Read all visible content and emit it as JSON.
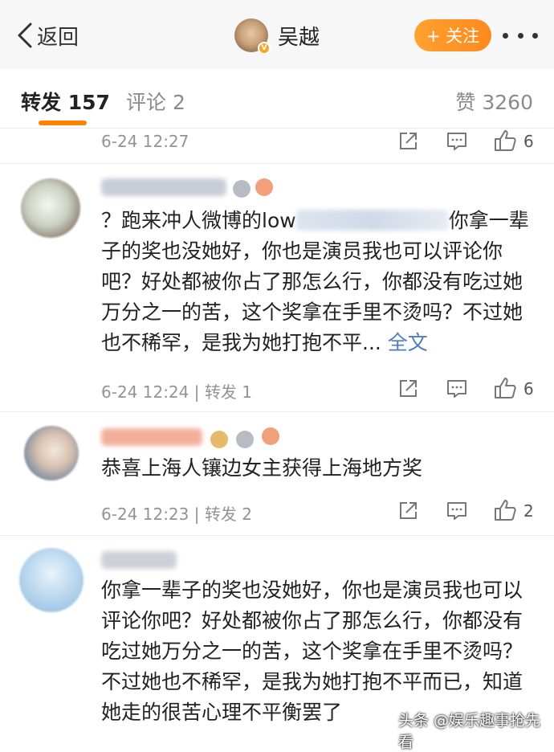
{
  "topbar": {
    "back_label": "返回",
    "username": "吴越",
    "follow_label": "+ 关注"
  },
  "tabs": {
    "repost": "转发 157",
    "comment": "评论 2",
    "likes": "赞 3260"
  },
  "rows": [
    {
      "meta": "6-24 12:27",
      "likes": "6"
    },
    {
      "meta": "6-24 12:24 | 转发 1",
      "likes": "6"
    },
    {
      "meta": "6-24 12:23 | 转发 2",
      "likes": "2"
    }
  ],
  "comments": [
    {
      "text_before": "？跑来冲人微博的low",
      "text_after": "你拿一辈子的奖也没她好，你也是演员我也可以评论你吧？好处都被你占了那怎么行，你都没有吃过她万分之一的苦，这个奖拿在手里不烫吗？不过她也不稀罕，是我为她打抱不平...",
      "full_link": "全文"
    },
    {
      "text": "恭喜上海人镶边女主获得上海地方奖"
    },
    {
      "text": "你拿一辈子的奖也没她好，你也是演员我也可以评论你吧？好处都被你占了那怎么行，你都没有吃过她万分之一的苦，这个奖拿在手里不烫吗？不过她也不稀罕，是我为她打抱不平而已，知道她走的很苦心理不平衡罢了"
    }
  ],
  "watermark": "头条 @娱乐趣事抢先看",
  "colors": {
    "accent": "#ff8200",
    "link": "#4f7bc2",
    "meta": "#939393"
  }
}
